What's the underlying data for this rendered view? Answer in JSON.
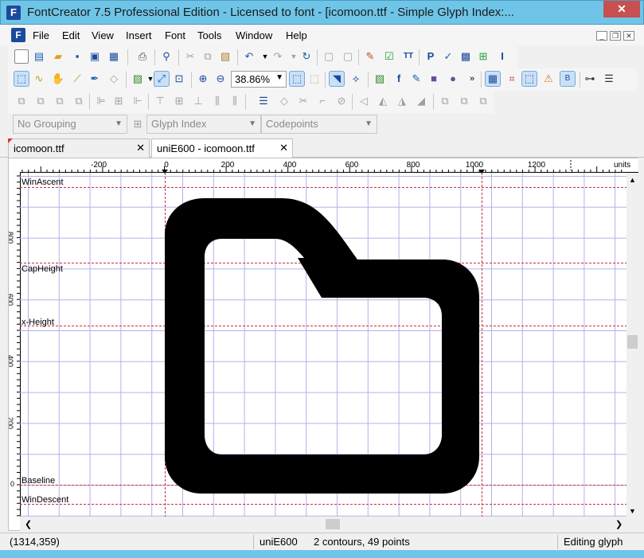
{
  "window": {
    "title": "FontCreator 7.5 Professional Edition - Licensed to font - [icomoon.ttf - Simple Glyph Index:...",
    "close_label": "✕",
    "app_icon": "F"
  },
  "menu": {
    "items": [
      "File",
      "Edit",
      "View",
      "Insert",
      "Font",
      "Tools",
      "Window",
      "Help"
    ]
  },
  "toolbar": {
    "zoom_value": "38.86%"
  },
  "grouping": {
    "grouping": "No Grouping",
    "sort": "Glyph Index",
    "display": "Codepoints"
  },
  "tabs": [
    {
      "label": "icomoon.ttf",
      "active": false
    },
    {
      "label": "uniE600 - icomoon.ttf",
      "active": true
    }
  ],
  "editor": {
    "ruler": {
      "ticks": [
        "-200",
        "0",
        "200",
        "400",
        "600",
        "800",
        "1000",
        "1200"
      ],
      "units": "units"
    },
    "left_ruler": [
      "800",
      "600",
      "400",
      "200",
      "0"
    ],
    "metric_lines": {
      "win_ascent": "WinAscent",
      "cap_height": "CapHeight",
      "x_height": "x-Height",
      "baseline": "Baseline",
      "win_descent": "WinDescent"
    },
    "colors": {
      "grid": "#b6b0ea",
      "metric_line": "#c0304a",
      "glyph": "#000000"
    }
  },
  "status": {
    "coordinates": "(1314,359)",
    "glyph": "uniE600",
    "info": "2 contours, 49 points",
    "mode": "Editing glyph"
  }
}
